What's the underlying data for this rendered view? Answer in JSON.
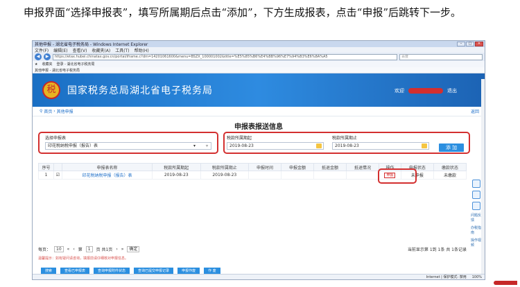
{
  "caption": "申报界面“选择申报表”，填写所属期后点击“添加”，下方生成报表，点击“申报”后跳转下一步。",
  "browser": {
    "title": "其他申报 - 湖北省电子税务局 - Windows Internet Explorer",
    "menu": [
      "文件(F)",
      "编辑(E)",
      "查看(V)",
      "收藏夹(A)",
      "工具(T)",
      "帮助(H)"
    ],
    "url": "https://etax.hubei.chinatax.gov.cn/portal/iframe.c?dm=14201061600&menu=BSZX_100001002&title=%E5%85%B6%E4%BB%96%E7%94%B3%E6%8A%A5",
    "search_placeholder": "百度",
    "favorites": [
      "收藏夹",
      "登录 - 湖北省电子税务局"
    ],
    "tab": "其他申报 - 湖北省电子税务局"
  },
  "header": {
    "title": "国家税务总局湖北省电子税务局",
    "welcome": "欢迎",
    "logout": "退出"
  },
  "breadcrumb": {
    "home": "首页",
    "current": "其他申报",
    "back": "返回"
  },
  "page_title": "申报表报送信息",
  "form": {
    "select_label": "选择申报表",
    "select_value": "印花税纳税申报（报告）表",
    "start_label": "税款所属期起",
    "start_value": "2019-08-23",
    "end_label": "税款所属期止",
    "end_value": "2019-08-23",
    "add_button": "添 加"
  },
  "table": {
    "headers": [
      "序号",
      "",
      "申报表名称",
      "税款所属期起",
      "税款所属期止",
      "申报时间",
      "申报金额",
      "抵退金额",
      "抵退情况",
      "操作",
      "申报状态",
      "缴款状态"
    ],
    "rows": [
      {
        "index": "1",
        "name": "印花税纳税申报（报告）表",
        "start": "2019-08-23",
        "end": "2019-08-23",
        "op": "申报",
        "status": "未申报",
        "pay": "未缴款"
      }
    ]
  },
  "side_tools": [
    "问题反馈",
    "办税指南",
    "操作视频"
  ],
  "pager": {
    "per_page_label": "每页：",
    "per_page": "10",
    "page_label": "第",
    "page": "1",
    "total_pages": "页 共1页",
    "go": "确定",
    "summary": "当前显示第 1到 1条 共 1条记录"
  },
  "notice": "温馨提示：如有疑问请咨询，填报前请仔细核对申报信息。",
  "bottom_buttons": [
    "搜索",
    "查看已申报表",
    "查询申报附件状态",
    "查询已提交申报记录",
    "申报作废",
    "作 废"
  ],
  "status": {
    "zone": "Internet | 保护模式: 禁用",
    "zoom": "100%"
  },
  "colors": {
    "banner": "#1f75cc",
    "highlight": "#d32f2f",
    "button": "#2b8fe0"
  }
}
